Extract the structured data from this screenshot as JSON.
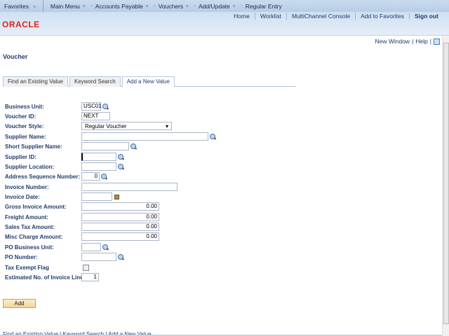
{
  "nav": {
    "favorites": "Favorites",
    "main_menu": "Main Menu",
    "crumbs": [
      "Accounts Payable",
      "Vouchers",
      "Add/Update",
      "Regular Entry"
    ]
  },
  "header": {
    "links": [
      "Home",
      "Worklist",
      "MultiChannel Console",
      "Add to Favorites",
      "Sign out"
    ],
    "logo": "ORACLE"
  },
  "utility": {
    "new_window": "New Window",
    "help": "Help"
  },
  "page_title": "Voucher",
  "tabs": [
    "Find an Existing Value",
    "Keyword Search",
    "Add a New Value"
  ],
  "form": {
    "business_unit": {
      "label": "Business Unit:",
      "value": "USC01"
    },
    "voucher_id": {
      "label": "Voucher ID:",
      "value": "NEXT"
    },
    "voucher_style": {
      "label": "Voucher Style:",
      "value": "Regular Voucher"
    },
    "supplier_name": {
      "label": "Supplier Name:",
      "value": ""
    },
    "short_supplier_name": {
      "label": "Short Supplier Name:",
      "value": ""
    },
    "supplier_id": {
      "label": "Supplier ID:",
      "value": ""
    },
    "supplier_location": {
      "label": "Supplier Location:",
      "value": ""
    },
    "address_seq": {
      "label": "Address Sequence Number:",
      "value": "0"
    },
    "invoice_number": {
      "label": "Invoice Number:",
      "value": ""
    },
    "invoice_date": {
      "label": "Invoice Date:",
      "value": ""
    },
    "gross_invoice": {
      "label": "Gross Invoice Amount:",
      "value": "0.00"
    },
    "freight": {
      "label": "Freight Amount:",
      "value": "0.00"
    },
    "sales_tax": {
      "label": "Sales Tax Amount:",
      "value": "0.00"
    },
    "misc_charge": {
      "label": "Misc Charge Amount:",
      "value": "0.00"
    },
    "po_business_unit": {
      "label": "PO Business Unit:",
      "value": ""
    },
    "po_number": {
      "label": "PO Number:",
      "value": ""
    },
    "tax_exempt": {
      "label": "Tax Exempt Flag",
      "checked": false
    },
    "est_lines": {
      "label": "Estimated No. of Invoice Lines:",
      "value": "1"
    }
  },
  "add_button": "Add",
  "bottom_links": "Find an Existing Value | Keyword Search | Add a New Value"
}
